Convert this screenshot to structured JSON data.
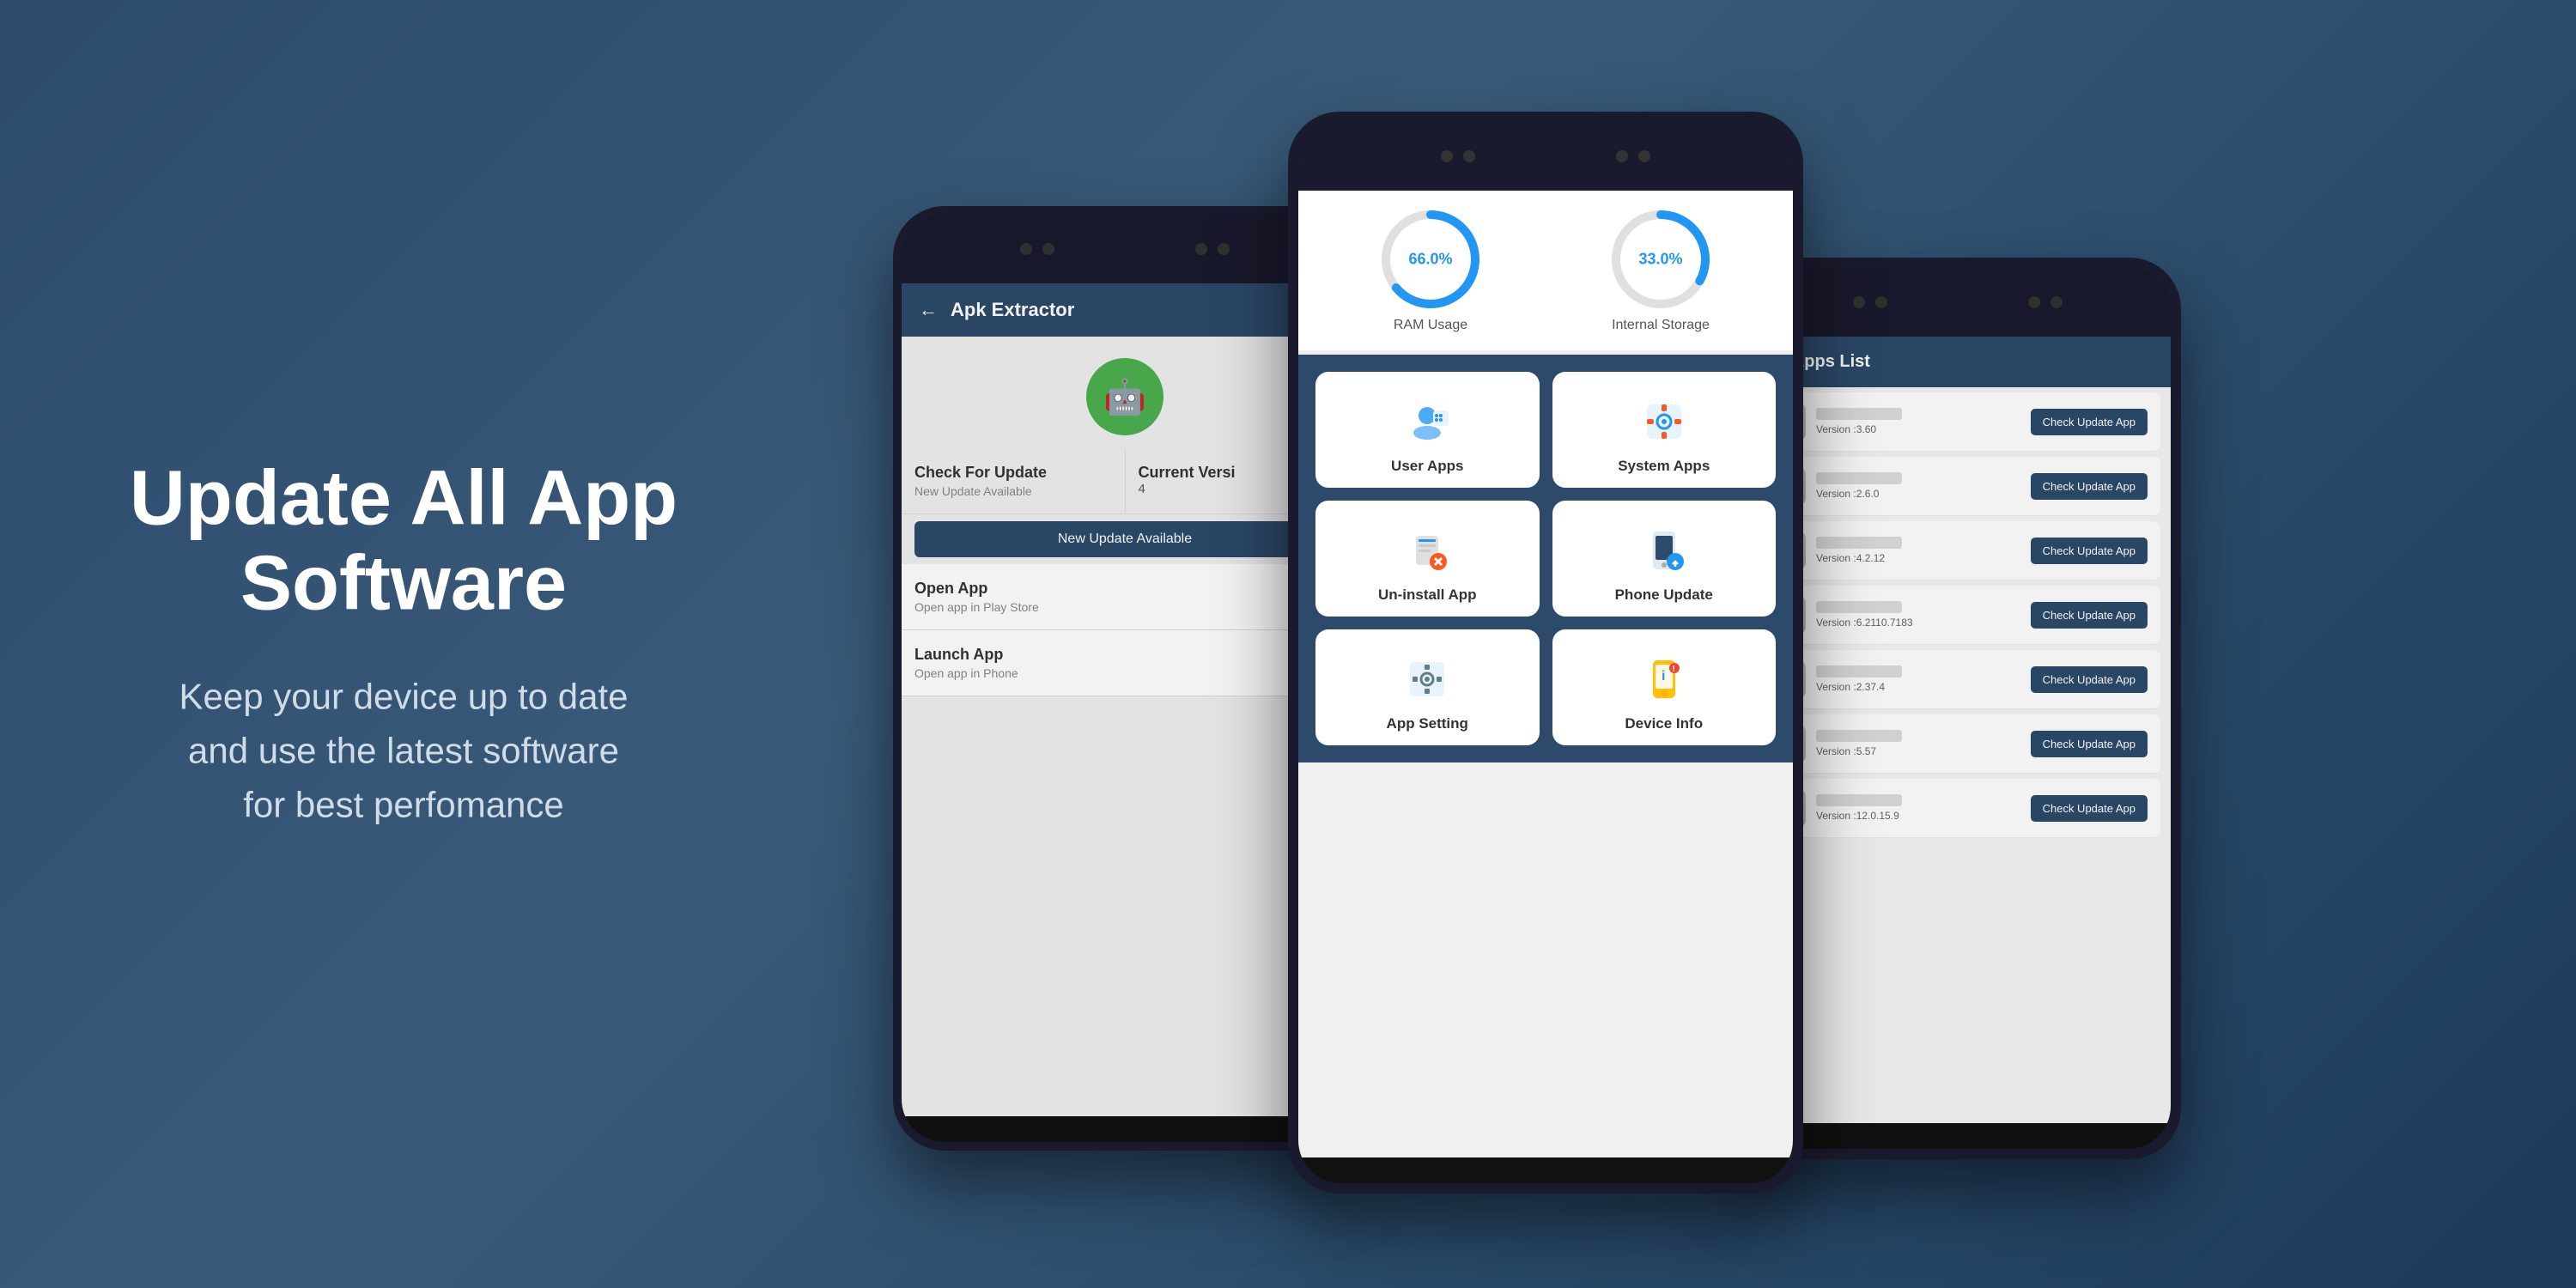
{
  "hero": {
    "title": "Update All App Software",
    "subtitle": "Keep your device up to date\nand use the latest software\nfor best perfomance"
  },
  "phone_left": {
    "header_title": "Apk Extractor",
    "back_icon": "←",
    "android_icon": "🤖",
    "check_for_update": "Check For Update",
    "new_update_available_sub": "New Update Available",
    "current_version_label": "Current Versi",
    "current_version_value": "4",
    "update_btn_label": "New Update Available",
    "open_app_label": "Open App",
    "open_app_sub": "Open app in Play Store",
    "launch_app_label": "Launch App",
    "launch_app_sub": "Open app in Phone"
  },
  "phone_center": {
    "ram_usage_label": "RAM Usage",
    "ram_percent": "66.0%",
    "ram_value": 66,
    "storage_label": "Internal Storage",
    "storage_percent": "33.0%",
    "storage_value": 33,
    "grid_items": [
      {
        "id": "user-apps",
        "icon": "👤",
        "label": "User Apps"
      },
      {
        "id": "system-apps",
        "icon": "⚙️",
        "label": "System Apps"
      },
      {
        "id": "uninstall-app",
        "icon": "📲",
        "label": "Un-install App"
      },
      {
        "id": "phone-update",
        "icon": "📱",
        "label": "Phone Update"
      },
      {
        "id": "app-setting",
        "icon": "🔧",
        "label": "App Setting"
      },
      {
        "id": "device-info",
        "icon": "📋",
        "label": "Device Info"
      }
    ]
  },
  "phone_right": {
    "header_title": "ser Apps List",
    "apps": [
      {
        "version": "Version :3.60",
        "btn_label": "Check Update App"
      },
      {
        "version": "Version :2.6.0",
        "btn_label": "Check Update App"
      },
      {
        "version": "Version :4.2.12",
        "btn_label": "Check Update App"
      },
      {
        "version": "Version :6.2110.7183",
        "btn_label": "Check Update App"
      },
      {
        "version": "Version :2.37.4",
        "btn_label": "Check Update App"
      },
      {
        "version": "Version :5.57",
        "btn_label": "Check Update App"
      },
      {
        "version": "Version :12.0.15.9",
        "btn_label": "Check Update App"
      }
    ]
  }
}
